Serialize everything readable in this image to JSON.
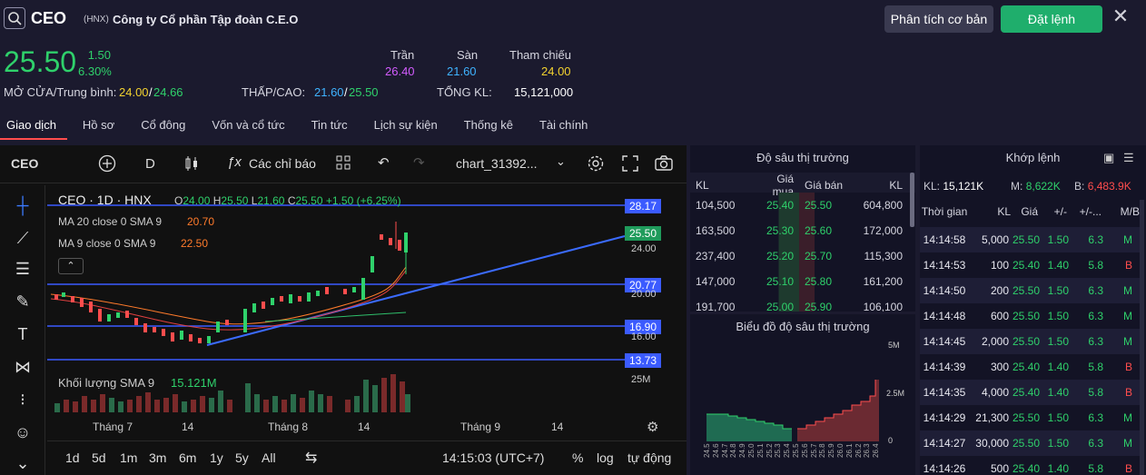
{
  "header": {
    "ticker": "CEO",
    "exchange": "(HNX)",
    "company": "Công ty Cổ phần Tập đoàn C.E.O",
    "btn_analysis": "Phân tích cơ bản",
    "btn_order": "Đặt lệnh",
    "close_glyph": "✕"
  },
  "quote": {
    "price": "25.50",
    "change": "1.50",
    "change_pct": "6.30%",
    "ceiling_label": "Trần",
    "ceiling": "26.40",
    "floor_label": "Sàn",
    "floor": "21.60",
    "ref_label": "Tham chiếu",
    "ref": "24.00",
    "open_label": "MỞ CỬA/Trung bình:",
    "open": "24.00",
    "avg": "24.66",
    "lowhigh_label": "THẤP/CAO:",
    "low": "21.60",
    "high": "25.50",
    "volume_label": "TỔNG KL:",
    "volume": "15,121,000"
  },
  "tabs": [
    "Giao dịch",
    "Hồ sơ",
    "Cổ đông",
    "Vốn và cổ tức",
    "Tin tức",
    "Lịch sự kiện",
    "Thống kê",
    "Tài chính"
  ],
  "chart": {
    "symbol": "CEO",
    "interval": "D",
    "indicators_label": "Các chỉ báo",
    "chart_name": "chart_31392...",
    "legend_title": "CEO · 1D · HNX",
    "ohlc": {
      "o": "24.00",
      "h": "25.50",
      "l": "21.60",
      "c": "25.50",
      "chg": "+1.50 (+6.25%)"
    },
    "ma20": "MA 20 close 0 SMA 9",
    "ma20_val": "20.70",
    "ma9": "MA 9 close 0 SMA 9",
    "ma9_val": "22.50",
    "vol_label": "Khối lượng SMA 9",
    "vol_val": "15.121M",
    "vol_axis": "25M",
    "price_axis": [
      "28.17",
      "25.50",
      "24.00",
      "20.77",
      "20.00",
      "16.90",
      "16.00",
      "13.73"
    ],
    "x_axis": [
      "Tháng 7",
      "14",
      "Tháng 8",
      "14",
      "Tháng 9",
      "14"
    ],
    "ranges": [
      "1d",
      "5d",
      "1m",
      "3m",
      "6m",
      "1y",
      "5y",
      "All"
    ],
    "time": "14:15:03 (UTC+7)",
    "pct": "%",
    "log": "log",
    "auto": "tự động"
  },
  "depth": {
    "title": "Độ sâu thị trường",
    "headers": [
      "KL",
      "Giá mua",
      "Giá bán",
      "KL"
    ],
    "rows": [
      [
        "104,500",
        "25.40",
        "25.50",
        "604,800"
      ],
      [
        "163,500",
        "25.30",
        "25.60",
        "172,000"
      ],
      [
        "237,400",
        "25.20",
        "25.70",
        "115,300"
      ],
      [
        "147,000",
        "25.10",
        "25.80",
        "161,200"
      ],
      [
        "191,700",
        "25.00",
        "25.90",
        "106,100"
      ]
    ]
  },
  "depth_chart": {
    "title": "Biểu đồ độ sâu thị trường",
    "y_axis": [
      "5M",
      "2.5M",
      "0"
    ],
    "x_labels": [
      "24.5",
      "24.6",
      "24.7",
      "24.8",
      "24.9",
      "25.0",
      "25.1",
      "25.2",
      "25.3",
      "25.4",
      "25.5",
      "25.6",
      "25.7",
      "25.8",
      "25.9",
      "26.0",
      "26.1",
      "26.2",
      "26.3",
      "26.4"
    ]
  },
  "match": {
    "title": "Khớp lệnh",
    "kl_label": "KL:",
    "kl": "15,121K",
    "m_label": "M:",
    "m": "8,622K",
    "b_label": "B:",
    "b": "6,483.9K",
    "headers": [
      "Thời gian",
      "KL",
      "Giá",
      "+/-",
      "+/-...",
      "M/B"
    ],
    "rows": [
      [
        "14:14:58",
        "5,000",
        "25.50",
        "1.50",
        "6.3",
        "M"
      ],
      [
        "14:14:53",
        "100",
        "25.40",
        "1.40",
        "5.8",
        "B"
      ],
      [
        "14:14:50",
        "200",
        "25.50",
        "1.50",
        "6.3",
        "M"
      ],
      [
        "14:14:48",
        "600",
        "25.50",
        "1.50",
        "6.3",
        "M"
      ],
      [
        "14:14:45",
        "2,000",
        "25.50",
        "1.50",
        "6.3",
        "M"
      ],
      [
        "14:14:39",
        "300",
        "25.40",
        "1.40",
        "5.8",
        "B"
      ],
      [
        "14:14:35",
        "4,000",
        "25.40",
        "1.40",
        "5.8",
        "B"
      ],
      [
        "14:14:29",
        "21,300",
        "25.50",
        "1.50",
        "6.3",
        "M"
      ],
      [
        "14:14:27",
        "30,000",
        "25.50",
        "1.50",
        "6.3",
        "M"
      ],
      [
        "14:14:26",
        "500",
        "25.40",
        "1.40",
        "5.8",
        "B"
      ]
    ]
  },
  "colors": {
    "up": "#2fd16b",
    "down": "#ff4d4d",
    "ceiling": "#d35cff",
    "floor": "#3fb3ff",
    "ref": "#f3d22f",
    "accent": "#1fae6c"
  }
}
